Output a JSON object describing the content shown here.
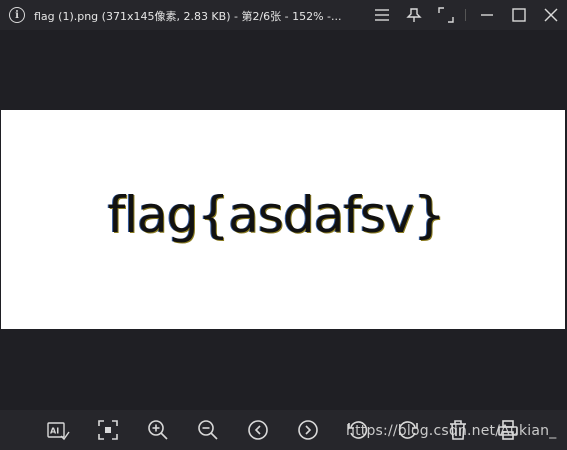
{
  "window": {
    "title": "flag (1).png (371x145像素, 2.83 KB) - 第2/6张 - 152% -..."
  },
  "image": {
    "text": "flag{asdafsv}"
  },
  "watermark": {
    "text": "https://blog.csdn.net/Aukian_"
  },
  "icons": {
    "info": "info-icon",
    "menu": "menu-icon",
    "pin": "pin-icon",
    "fullscreen": "fullscreen-icon",
    "minimize": "minimize-icon",
    "maximize": "maximize-icon",
    "close": "close-icon",
    "ai": "ai-icon",
    "fit": "fit-screen-icon",
    "zoom_in": "zoom-in-icon",
    "zoom_out": "zoom-out-icon",
    "prev": "previous-icon",
    "next": "next-icon",
    "rotate_left": "rotate-left-icon",
    "rotate_right": "rotate-right-icon",
    "delete": "delete-icon",
    "print": "print-icon"
  },
  "colors": {
    "background": "#1f1f24",
    "bars": "#26262b",
    "icon": "#d9d9d9"
  }
}
